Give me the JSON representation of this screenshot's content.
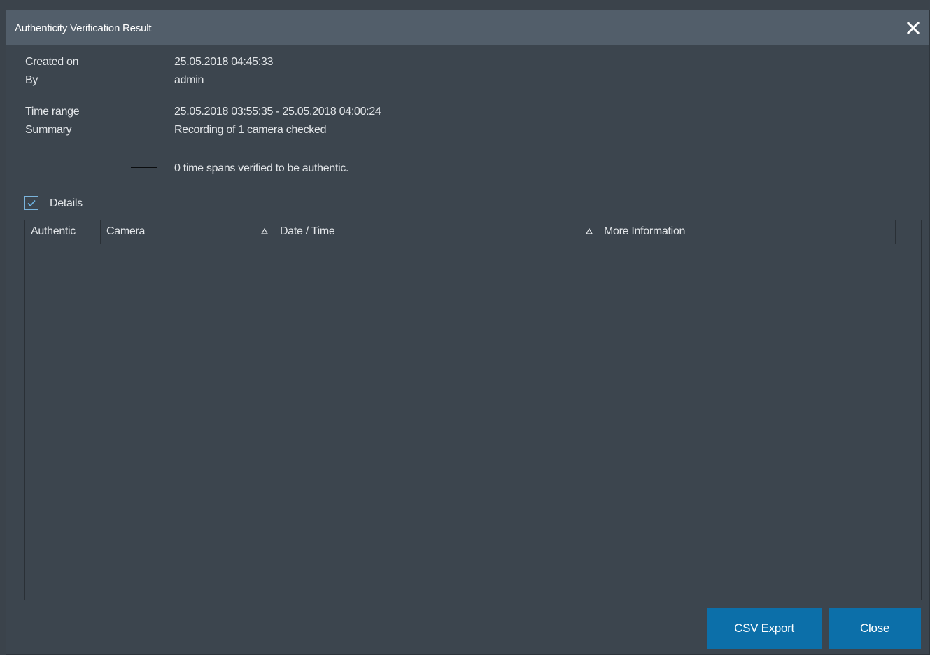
{
  "dialog": {
    "title": "Authenticity Verification Result"
  },
  "info": {
    "created_on_label": "Created on",
    "created_on_value": "25.05.2018 04:45:33",
    "by_label": "By",
    "by_value": "admin",
    "time_range_label": "Time range",
    "time_range_value": "25.05.2018 03:55:35 - 25.05.2018 04:00:24",
    "summary_label": "Summary",
    "summary_value": "Recording of 1 camera checked",
    "legend_text": "0 time spans verified to be authentic."
  },
  "details": {
    "label": "Details",
    "checked": true
  },
  "table": {
    "columns": [
      "Authentic",
      "Camera",
      "Date / Time",
      "More Information"
    ],
    "rows": []
  },
  "buttons": {
    "csv_export": "CSV Export",
    "close": "Close"
  },
  "colors": {
    "accent": "#0c6fa9",
    "titlebar": "#525e6a",
    "background": "#3c454e"
  },
  "icons": {
    "close": "close-icon",
    "check": "checkmark-icon",
    "sort": "sort-ascending-icon"
  }
}
